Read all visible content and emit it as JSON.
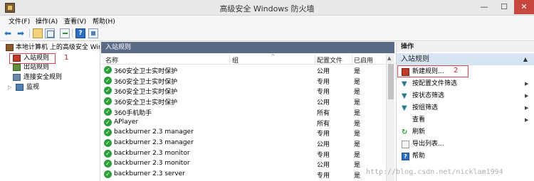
{
  "window": {
    "title": "高级安全 Windows 防火墙",
    "min": "—",
    "max": "☐",
    "close": "✕"
  },
  "menu": [
    "文件(F)",
    "操作(A)",
    "查看(V)",
    "帮助(H)"
  ],
  "toolbar": {
    "back": "⬅",
    "forward": "➡",
    "help": "?"
  },
  "tree": {
    "root": "本地计算机 上的高级安全 Windows 防火墙",
    "items": [
      {
        "label": "入站规则",
        "icon": "inbound-rules-icon"
      },
      {
        "label": "出站规则",
        "icon": "outbound-rules-icon"
      },
      {
        "label": "连接安全规则",
        "icon": "connection-security-icon"
      },
      {
        "label": "监视",
        "icon": "monitor-icon"
      }
    ],
    "annotation": "1"
  },
  "center": {
    "header": "入站规则",
    "columns": {
      "name": "名称",
      "group": "组",
      "profile": "配置文件",
      "enabled": "已启用"
    },
    "rows": [
      {
        "name": "360安全卫士实时保护",
        "profile": "公用",
        "enabled": "是"
      },
      {
        "name": "360安全卫士实时保护",
        "profile": "专用",
        "enabled": "是"
      },
      {
        "name": "360安全卫士实时保护",
        "profile": "专用",
        "enabled": "是"
      },
      {
        "name": "360安全卫士实时保护",
        "profile": "公用",
        "enabled": "是"
      },
      {
        "name": "360手机助手",
        "profile": "所有",
        "enabled": "是"
      },
      {
        "name": "APlayer",
        "profile": "所有",
        "enabled": "是"
      },
      {
        "name": "backburner 2.3 manager",
        "profile": "专用",
        "enabled": "是"
      },
      {
        "name": "backburner 2.3 manager",
        "profile": "公用",
        "enabled": "是"
      },
      {
        "name": "backburner 2.3 monitor",
        "profile": "专用",
        "enabled": "是"
      },
      {
        "name": "backburner 2.3 monitor",
        "profile": "公用",
        "enabled": "是"
      },
      {
        "name": "backburner 2.3 server",
        "profile": "专用",
        "enabled": "是"
      }
    ]
  },
  "actions": {
    "title": "操作",
    "section": "入站规则",
    "annotation": "2",
    "items": [
      {
        "label": "新建规则...",
        "icon": "new-rule-icon",
        "submenu": false
      },
      {
        "label": "按配置文件筛选",
        "icon": "filter-icon",
        "submenu": true
      },
      {
        "label": "按状态筛选",
        "icon": "filter-icon",
        "submenu": true
      },
      {
        "label": "按组筛选",
        "icon": "filter-icon",
        "submenu": true
      },
      {
        "label": "查看",
        "icon": "",
        "submenu": true
      },
      {
        "label": "刷新",
        "icon": "refresh-icon",
        "submenu": false
      },
      {
        "label": "导出列表...",
        "icon": "export-icon",
        "submenu": false
      },
      {
        "label": "帮助",
        "icon": "help-icon",
        "submenu": false
      }
    ]
  },
  "watermark": "http://blog.csdn.net/nicklam1994"
}
